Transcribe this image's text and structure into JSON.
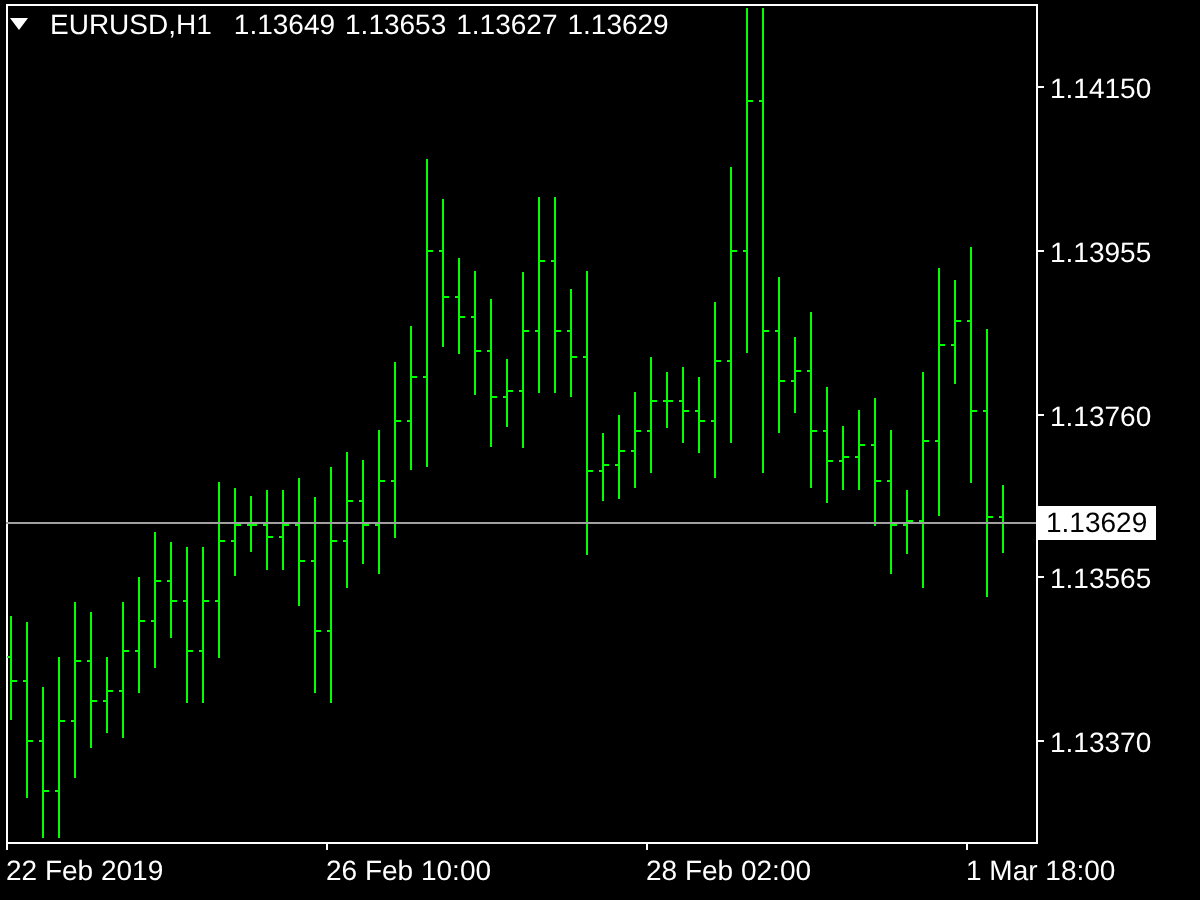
{
  "header": {
    "symbol": "EURUSD,H1",
    "ohlc": [
      "1.13649",
      "1.13653",
      "1.13627",
      "1.13629"
    ]
  },
  "price_axis": {
    "labels": [
      "1.14150",
      "1.13955",
      "1.13760",
      "1.13565",
      "1.13370"
    ]
  },
  "current_price": {
    "label": "1.13629"
  },
  "time_axis": {
    "labels": [
      "22 Feb 2019",
      "26 Feb 10:00",
      "28 Feb 02:00",
      "1 Mar 18:00"
    ]
  }
}
